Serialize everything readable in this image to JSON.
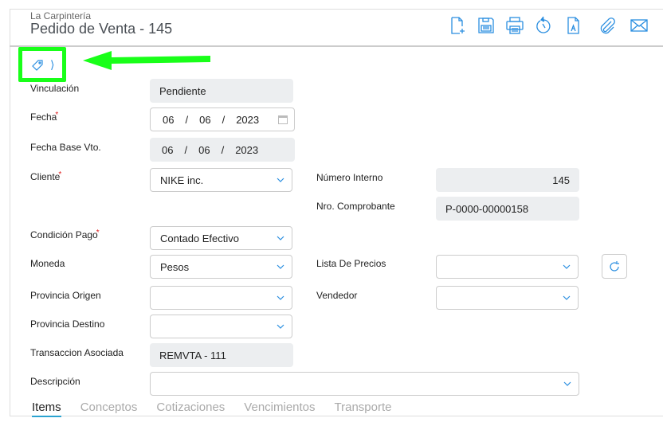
{
  "header": {
    "company": "La Carpintería",
    "title": "Pedido de Venta - 145"
  },
  "toolbar": [
    "new-document-icon",
    "save-icon",
    "print-icon",
    "history-icon",
    "pdf-document-icon",
    "attach-icon",
    "email-icon"
  ],
  "form": {
    "vinculacion": {
      "label": "Vinculación",
      "value": "Pendiente"
    },
    "fecha": {
      "label": "Fecha",
      "day": "06",
      "month": "06",
      "year": "2023"
    },
    "fecha_base": {
      "label": "Fecha Base Vto.",
      "day": "06",
      "month": "06",
      "year": "2023"
    },
    "cliente": {
      "label": "Cliente",
      "value": "NIKE inc."
    },
    "numero_interno": {
      "label": "Número Interno",
      "value": "145"
    },
    "nro_comprobante": {
      "label": "Nro. Comprobante",
      "value": "P-0000-00000158"
    },
    "condicion_pago": {
      "label": "Condición Pago",
      "value": "Contado Efectivo"
    },
    "moneda": {
      "label": "Moneda",
      "value": "Pesos"
    },
    "lista_precios": {
      "label": "Lista De Precios",
      "value": ""
    },
    "provincia_origen": {
      "label": "Provincia Origen",
      "value": ""
    },
    "vendedor": {
      "label": "Vendedor",
      "value": ""
    },
    "provincia_destino": {
      "label": "Provincia Destino",
      "value": ""
    },
    "transaccion": {
      "label": "Transaccion Asociada",
      "value": "REMVTA - 111"
    },
    "descripcion": {
      "label": "Descripción",
      "value": ""
    },
    "required_mark": "*",
    "date_sep": "/"
  },
  "tabs": [
    "Items",
    "Conceptos",
    "Cotizaciones",
    "Vencimientos",
    "Transporte"
  ],
  "colors": {
    "accent": "#2a8ee0",
    "annotation": "#19ff19"
  }
}
